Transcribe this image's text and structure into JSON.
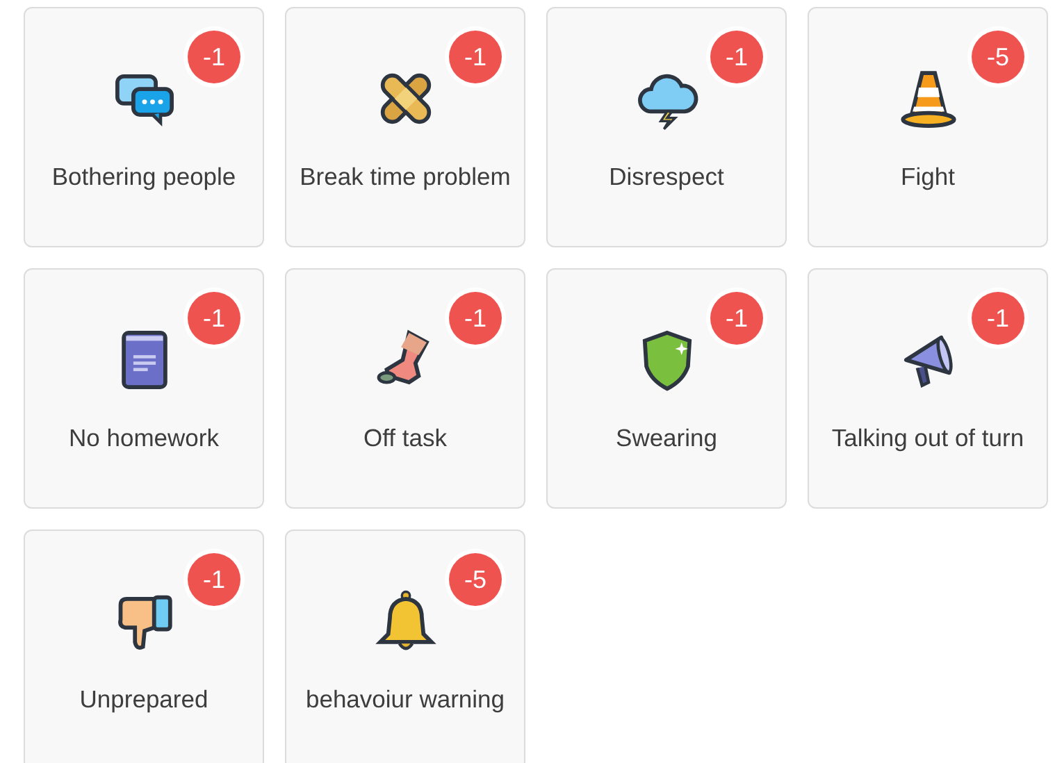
{
  "behaviours": [
    {
      "label": "Bothering people",
      "points": "-1",
      "kind": "chat"
    },
    {
      "label": "Break time problem",
      "points": "-1",
      "kind": "bandage"
    },
    {
      "label": "Disrespect",
      "points": "-1",
      "kind": "cloud"
    },
    {
      "label": "Fight",
      "points": "-5",
      "kind": "cone"
    },
    {
      "label": "No homework",
      "points": "-1",
      "kind": "book"
    },
    {
      "label": "Off task",
      "points": "-1",
      "kind": "boot"
    },
    {
      "label": "Swearing",
      "points": "-1",
      "kind": "shield"
    },
    {
      "label": "Talking out of turn",
      "points": "-1",
      "kind": "megaphone"
    },
    {
      "label": "Unprepared",
      "points": "-1",
      "kind": "thumbs-down"
    },
    {
      "label": "behavoiur warning",
      "points": "-5",
      "kind": "bell"
    }
  ]
}
